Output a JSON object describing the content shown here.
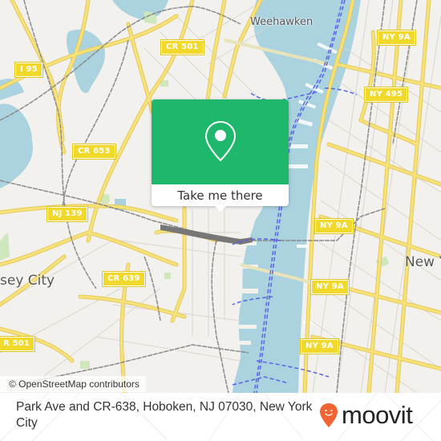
{
  "map": {
    "colors": {
      "land": "#f2f1ed",
      "water": "#aad3df",
      "park": "#cfe7bd",
      "major_road": "#f7e27a",
      "road_casing": "#e8cd5c",
      "minor_road": "#d9d6cf",
      "rail": "#808080",
      "ferry": "#5b63e6"
    },
    "place_labels": [
      {
        "name": "weehawken-label",
        "text": "Weehawken"
      },
      {
        "name": "new-york-label",
        "text": "New Y"
      },
      {
        "name": "jersey-city-label",
        "text": "sey City"
      }
    ],
    "road_shields": [
      {
        "name": "i95-shield",
        "text": "I 95"
      },
      {
        "name": "cr501-north-shield",
        "text": "CR 501"
      },
      {
        "name": "cr653-shield",
        "text": "CR 653"
      },
      {
        "name": "nj139-shield",
        "text": "NJ 139"
      },
      {
        "name": "cr639-shield",
        "text": "CR 639"
      },
      {
        "name": "cr501-south-shield",
        "text": "R 501"
      },
      {
        "name": "ny9a-shield-1",
        "text": "NY 9A"
      },
      {
        "name": "ny495-shield",
        "text": "NY 495"
      },
      {
        "name": "ny9a-shield-2",
        "text": "NY 9A"
      },
      {
        "name": "ny9a-shield-3",
        "text": "NY 9A"
      },
      {
        "name": "ny9a-shield-4",
        "text": "NY 9A"
      }
    ],
    "attribution": "© OpenStreetMap contributors"
  },
  "popup": {
    "icon": "location-pin-icon",
    "button_label": "Take me there",
    "accent": "#1eb76b"
  },
  "footer": {
    "address": "Park Ave and CR-638, Hoboken, NJ 07030, New York City",
    "logo_text": "moovit",
    "logo_icon": "moovit-smiley-pin-icon",
    "logo_color": "#f26433"
  }
}
